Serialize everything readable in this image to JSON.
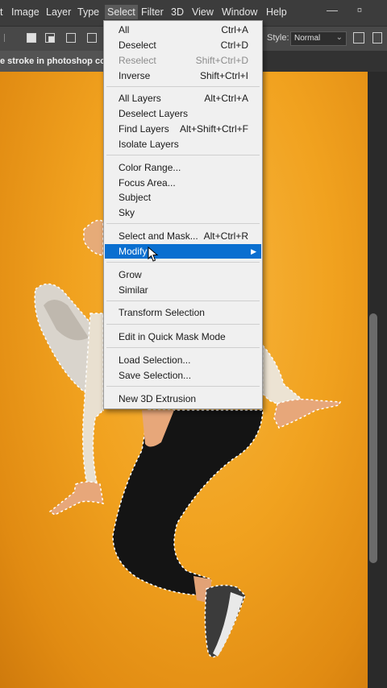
{
  "menubar": {
    "items": [
      "t",
      "Image",
      "Layer",
      "Type",
      "Select",
      "Filter",
      "3D",
      "View",
      "Window",
      "Help"
    ],
    "active": "Select",
    "minimize_glyph": "—",
    "maximize_glyph": "▫"
  },
  "options_bar": {
    "style_label": "Style:",
    "style_value": "Normal",
    "chevron": "⌄"
  },
  "document": {
    "tab_title": "e stroke in photoshop cop"
  },
  "select_menu": {
    "groups": [
      [
        {
          "label": "All",
          "shortcut": "Ctrl+A"
        },
        {
          "label": "Deselect",
          "shortcut": "Ctrl+D"
        },
        {
          "label": "Reselect",
          "shortcut": "Shift+Ctrl+D",
          "disabled": true
        },
        {
          "label": "Inverse",
          "shortcut": "Shift+Ctrl+I"
        }
      ],
      [
        {
          "label": "All Layers",
          "shortcut": "Alt+Ctrl+A"
        },
        {
          "label": "Deselect Layers",
          "shortcut": ""
        },
        {
          "label": "Find Layers",
          "shortcut": "Alt+Shift+Ctrl+F"
        },
        {
          "label": "Isolate Layers",
          "shortcut": ""
        }
      ],
      [
        {
          "label": "Color Range...",
          "shortcut": ""
        },
        {
          "label": "Focus Area...",
          "shortcut": ""
        },
        {
          "label": "Subject",
          "shortcut": ""
        },
        {
          "label": "Sky",
          "shortcut": ""
        }
      ],
      [
        {
          "label": "Select and Mask...",
          "shortcut": "Alt+Ctrl+R"
        },
        {
          "label": "Modify",
          "shortcut": "",
          "highlighted": true,
          "submenu_arrow": "▶"
        }
      ],
      [
        {
          "label": "Grow",
          "shortcut": ""
        },
        {
          "label": "Similar",
          "shortcut": ""
        }
      ],
      [
        {
          "label": "Transform Selection",
          "shortcut": ""
        }
      ],
      [
        {
          "label": "Edit in Quick Mask Mode",
          "shortcut": ""
        }
      ],
      [
        {
          "label": "Load Selection...",
          "shortcut": ""
        },
        {
          "label": "Save Selection...",
          "shortcut": ""
        }
      ],
      [
        {
          "label": "New 3D Extrusion",
          "shortcut": ""
        }
      ]
    ]
  },
  "colors": {
    "highlight": "#0a6fd0",
    "canvas_orange": "#f1a21f",
    "menubar_bg": "#3c3c3c"
  }
}
